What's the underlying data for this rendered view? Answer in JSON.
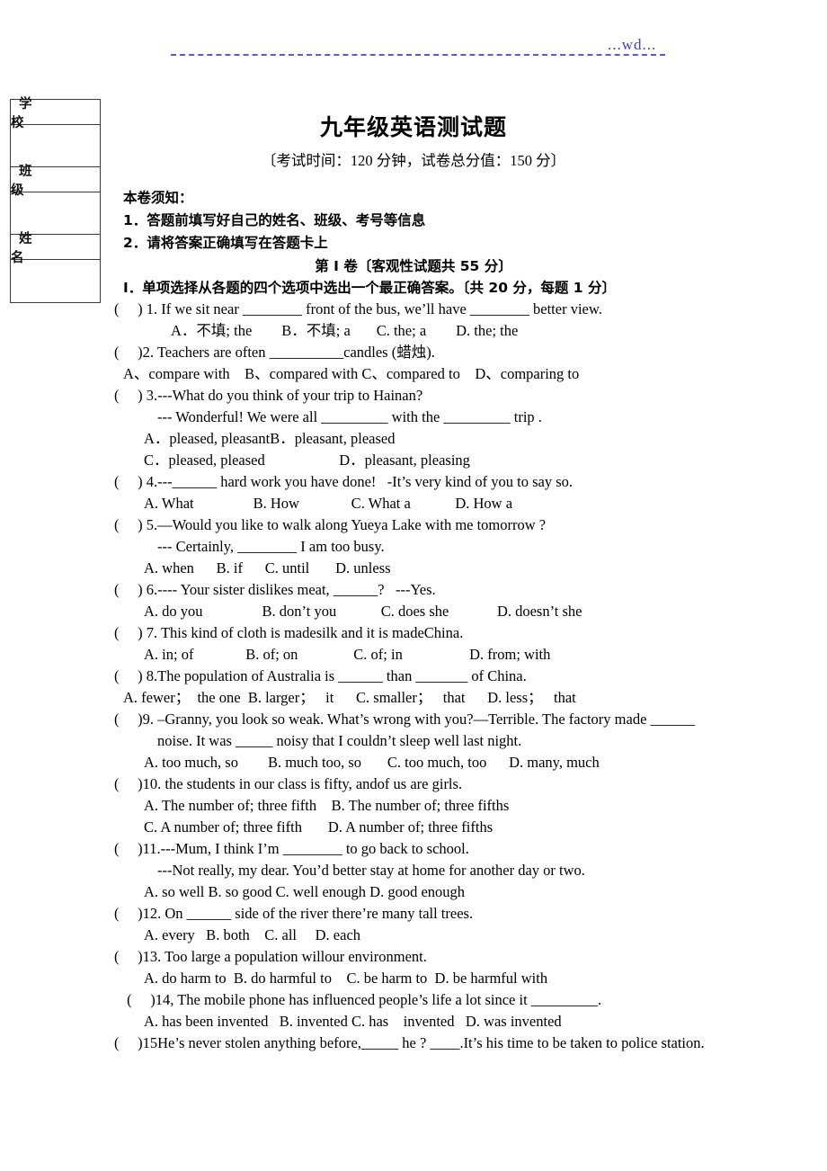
{
  "header": {
    "watermark": "...wd...",
    "rule_color": "#5a5ad8"
  },
  "info_table": {
    "rows": [
      {
        "label": "学　　校",
        "type": "labelled"
      },
      {
        "label": "",
        "type": "blank"
      },
      {
        "label": "班　　级",
        "type": "labelled"
      },
      {
        "label": "",
        "type": "blank"
      },
      {
        "label": "姓　　名",
        "type": "labelled"
      },
      {
        "label": "",
        "type": "blank"
      }
    ]
  },
  "title": "九年级英语测试题",
  "exam_meta": "〔考试时间：120 分钟，试卷总分值：150 分〕",
  "notice": {
    "title": "本卷须知：",
    "items": [
      "1．答题前填写好自己的姓名、班级、考号等信息",
      "2．请将答案正确填写在答题卡上"
    ]
  },
  "part_heading": "第 I 卷〔客观性试题共 55 分〕",
  "section_heading": "Ⅰ．单项选择从各题的四个选项中选出一个最正确答案。〔共 20 分，每题 1 分〕",
  "questions": [
    {
      "indent": "ind0",
      "text": "(     ) 1. If we sit near ________ front of the bus, we’ll have ________ better view."
    },
    {
      "indent": "ind4",
      "text": "A．不填; the        B．不填; a       C. the; a        D. the; the"
    },
    {
      "indent": "ind0",
      "text": "(     )2. Teachers are often __________candles (蜡烛)."
    },
    {
      "indent": "ind1",
      "text": "A、compare with    B、compared with C、compared to    D、comparing to"
    },
    {
      "indent": "ind0",
      "text": "(     ) 3.---What do you think of your trip to Hainan?"
    },
    {
      "indent": "ind3",
      "text": "--- Wonderful! We were all _________ with the _________ trip ."
    },
    {
      "indent": "ind2",
      "text": "A．pleased, pleasantB．pleasant, pleased"
    },
    {
      "indent": "ind2",
      "text": "C．pleased, pleased                    D．pleasant, pleasing"
    },
    {
      "indent": "ind0",
      "text": "(     ) 4.---______ hard work you have done!   -It’s very kind of you to say so."
    },
    {
      "indent": "ind2",
      "text": "A. What                B. How              C. What a            D. How a"
    },
    {
      "indent": "ind0",
      "text": "(     ) 5.—Would you like to walk along Yueya Lake with me tomorrow ?"
    },
    {
      "indent": "ind3",
      "text": "--- Certainly, ________ I am too busy."
    },
    {
      "indent": "ind2",
      "text": "A. when      B. if      C. until       D. unless"
    },
    {
      "indent": "ind0",
      "text": "(     ) 6.---- Your sister dislikes meat, ______?   ---Yes."
    },
    {
      "indent": "ind2",
      "text": "A. do you                B. don’t you            C. does she             D. doesn’t she"
    },
    {
      "indent": "ind0",
      "text": "(     ) 7. This kind of cloth is madesilk and it is madeChina."
    },
    {
      "indent": "ind2",
      "text": "A. in; of              B. of; on               C. of; in                  D. from; with"
    },
    {
      "indent": "ind0",
      "text": "(     ) 8.The population of Australia is ______ than _______ of China."
    },
    {
      "indent": "ind1",
      "text": "A. fewer；  the one  B. larger；   it      C. smaller；   that      D. less；   that"
    },
    {
      "indent": "ind0",
      "text": "(     )9. –Granny, you look so weak. What’s wrong with you?—Terrible. The factory made ______"
    },
    {
      "indent": "ind3",
      "text": "noise. It was _____ noisy that I couldn’t sleep well last night."
    },
    {
      "indent": "ind2",
      "text": "A. too much, so        B. much too, so       C. too much, too      D. many, much"
    },
    {
      "indent": "ind0",
      "text": "(     )10. the students in our class is fifty, andof us are girls."
    },
    {
      "indent": "ind2",
      "text": "A. The number of; three fifth    B. The number of; three fifths"
    },
    {
      "indent": "ind2",
      "text": "C. A number of; three fifth       D. A number of; three fifths"
    },
    {
      "indent": "ind0",
      "text": "(     )11.---Mum, I think I’m ________ to go back to school."
    },
    {
      "indent": "ind3",
      "text": "---Not really, my dear. You’d better stay at home for another day or two."
    },
    {
      "indent": "ind2",
      "text": "A. so well B. so good C. well enough D. good enough"
    },
    {
      "indent": "ind0",
      "text": "(     )12. On ______ side of the river there’re many tall trees."
    },
    {
      "indent": "ind2",
      "text": "A. every   B. both    C. all     D. each"
    },
    {
      "indent": "ind0",
      "text": "(     )13. Too large a population willour environment."
    },
    {
      "indent": "ind2",
      "text": "A. do harm to  B. do harmful to    C. be harm to  D. be harmful with"
    },
    {
      "indent": "ind1",
      "text": " (     )14, The mobile phone has influenced people’s life a lot since it _________."
    },
    {
      "indent": "ind2",
      "text": "A. has been invented   B. invented C. has    invented   D. was invented"
    },
    {
      "indent": "ind0",
      "text": "(     )15He’s never stolen anything before,_____ he ? ____.It’s his time to be taken to police station."
    }
  ]
}
